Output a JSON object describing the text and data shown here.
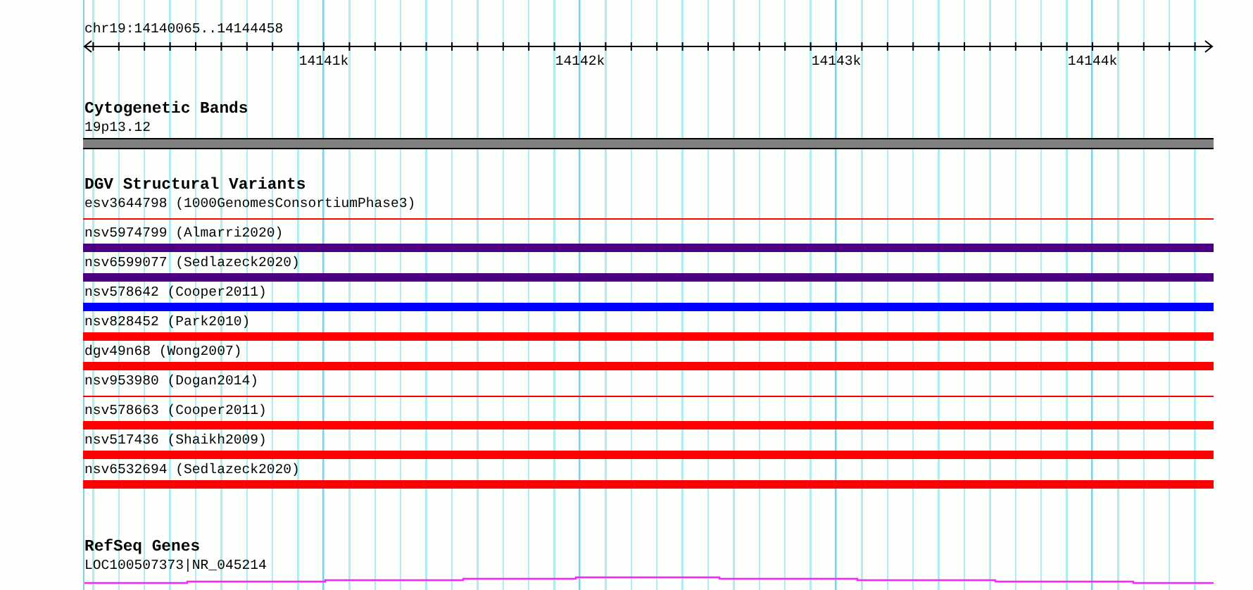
{
  "locus": "chr19:14140065..14144458",
  "ruler": {
    "ticks": [
      {
        "label": "14141k"
      },
      {
        "label": "14142k"
      },
      {
        "label": "14143k"
      },
      {
        "label": "14144k"
      }
    ]
  },
  "cytogenetic_bands": {
    "title": "Cytogenetic Bands",
    "features": [
      {
        "label": "19p13.12"
      }
    ]
  },
  "structural_variants": {
    "title": "DGV Structural Variants",
    "features": [
      {
        "label": "esv3644798 (1000GenomesConsortiumPhase3)",
        "kind": "line",
        "color": "#ff0000"
      },
      {
        "label": "nsv5974799 (Almarri2020)",
        "kind": "bar",
        "color": "#4b0082"
      },
      {
        "label": "nsv6599077 (Sedlazeck2020)",
        "kind": "bar",
        "color": "#4b0082"
      },
      {
        "label": "nsv578642 (Cooper2011)",
        "kind": "bar",
        "color": "#0000ff"
      },
      {
        "label": "nsv828452 (Park2010)",
        "kind": "bar",
        "color": "#ff0000"
      },
      {
        "label": "dgv49n68 (Wong2007)",
        "kind": "bar",
        "color": "#ff0000"
      },
      {
        "label": "nsv953980 (Dogan2014)",
        "kind": "line",
        "color": "#ff0000"
      },
      {
        "label": "nsv578663 (Cooper2011)",
        "kind": "bar",
        "color": "#ff0000"
      },
      {
        "label": "nsv517436 (Shaikh2009)",
        "kind": "bar",
        "color": "#ff0000"
      },
      {
        "label": "nsv6532694 (Sedlazeck2020)",
        "kind": "bar",
        "color": "#ff0000"
      }
    ]
  },
  "refseq_genes": {
    "title": "RefSeq Genes",
    "features": [
      {
        "label": "LOC100507373|NR_045214"
      }
    ]
  }
}
